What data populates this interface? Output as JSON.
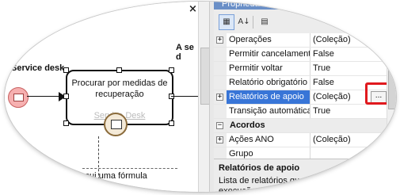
{
  "canvas": {
    "close_glyph": "×",
    "lane_label": "Service desk",
    "right_label": "A se\nd",
    "task_title": "Procurar por medidas de recuperação",
    "task_subtitle": "Service Desk",
    "note_text": "ssui uma fórmula"
  },
  "panel": {
    "title": "Propriedades",
    "toolbar": {
      "categorized_icon": "categorized-icon",
      "sort_icon": "sort-alphabetical-icon",
      "pages_icon": "property-pages-icon"
    },
    "rows": [
      {
        "type": "prop",
        "expandable": true,
        "name": "Operações",
        "value": "(Coleção)"
      },
      {
        "type": "prop",
        "expandable": false,
        "name": "Permitir cancelamento",
        "value": "False"
      },
      {
        "type": "prop",
        "expandable": false,
        "name": "Permitir voltar",
        "value": "True"
      },
      {
        "type": "prop",
        "expandable": false,
        "name": "Relatório obrigatório",
        "value": "False"
      },
      {
        "type": "prop",
        "expandable": true,
        "selected": true,
        "name": "Relatórios de apoio",
        "value": "(Coleção)"
      },
      {
        "type": "prop",
        "expandable": false,
        "name": "Transição automática",
        "value": "True"
      },
      {
        "type": "category",
        "name": "Acordos"
      },
      {
        "type": "prop",
        "expandable": true,
        "name": "Ações ANO",
        "value": "(Coleção)"
      },
      {
        "type": "prop",
        "expandable": false,
        "name": "Grupo",
        "value": ""
      }
    ],
    "ellipsis_label": "...",
    "description": {
      "title": "Relatórios de apoio",
      "text": "Lista de relatórios que ser... apoio na execução..."
    }
  },
  "colors": {
    "selection": "#3875d7",
    "highlight_box": "#e0191e",
    "title_bar": "#6a8fc7"
  }
}
